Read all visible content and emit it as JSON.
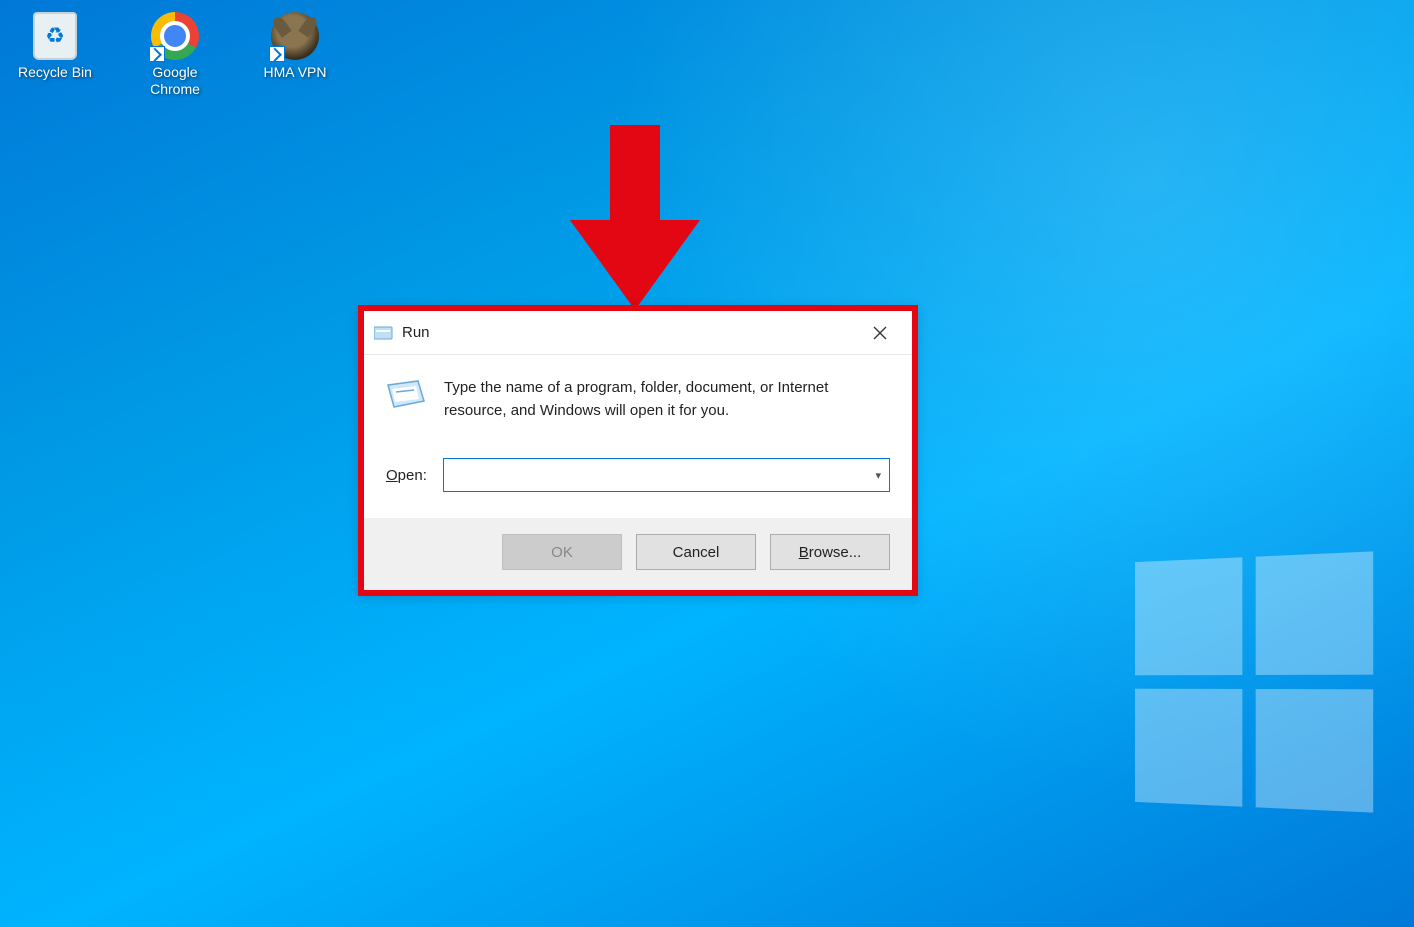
{
  "desktop_icons": [
    {
      "name": "recycle-bin",
      "label": "Recycle Bin"
    },
    {
      "name": "google-chrome",
      "label": "Google\nChrome"
    },
    {
      "name": "hma-vpn",
      "label": "HMA VPN"
    }
  ],
  "run_dialog": {
    "title": "Run",
    "description": "Type the name of a program, folder, document, or Internet resource, and Windows will open it for you.",
    "open_label": "Open:",
    "open_value": "",
    "buttons": {
      "ok": "OK",
      "cancel": "Cancel",
      "browse": "Browse..."
    }
  }
}
